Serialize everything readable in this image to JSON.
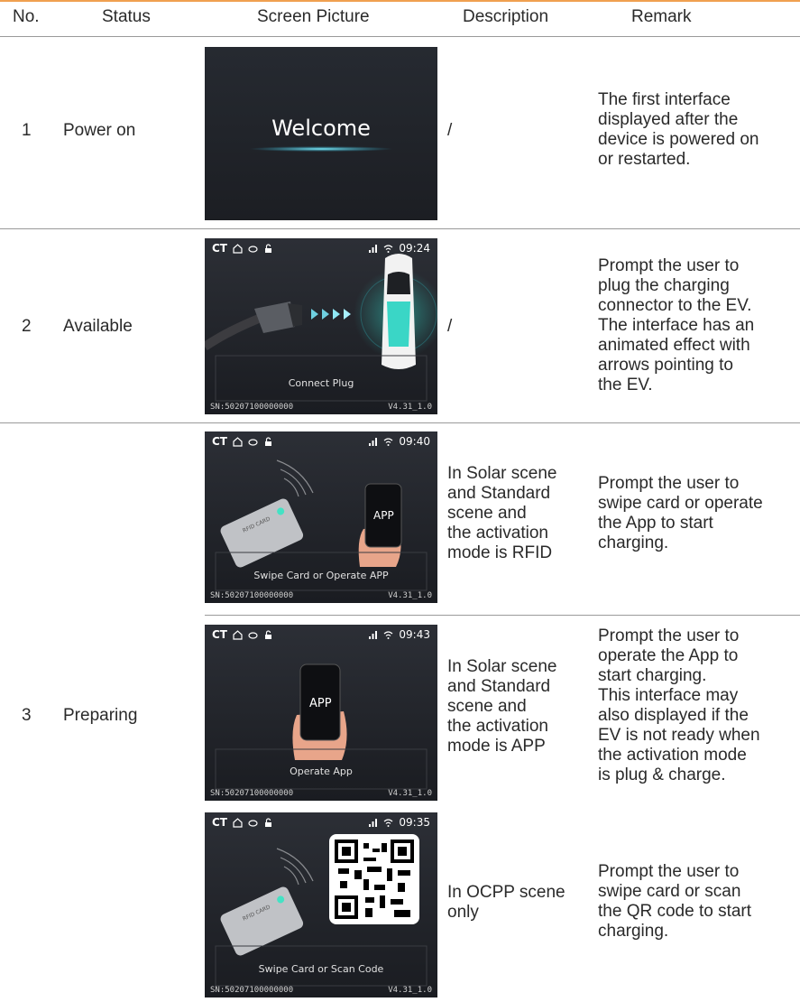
{
  "header": {
    "no": "No.",
    "status": "Status",
    "screen": "Screen Picture",
    "description": "Description",
    "remark": "Remark"
  },
  "rows": [
    {
      "no": "1",
      "status": "Power on",
      "description": "/",
      "remark": [
        "The first interface",
        "displayed after the",
        "device is powered on",
        "or restarted."
      ],
      "screen": {
        "title": "Welcome"
      }
    },
    {
      "no": "2",
      "status": "Available",
      "description": "/",
      "remark": [
        "Prompt the user to",
        "plug the charging",
        "connector to the EV.",
        "The interface has an",
        "animated effect with",
        "arrows pointing to",
        "the EV."
      ],
      "screen": {
        "status_left": "CT",
        "time": "09:24",
        "caption": "Connect Plug",
        "sn": "SN:50207100000000",
        "version": "V4.31_1.0"
      }
    }
  ],
  "group3": {
    "no": "3",
    "status": "Preparing",
    "subrows": [
      {
        "description": [
          "In Solar scene",
          "and Standard",
          "scene and",
          "the activation",
          "mode is RFID"
        ],
        "remark": [
          "Prompt the user to",
          "swipe card or operate",
          "the App to start",
          "charging."
        ],
        "screen": {
          "status_left": "CT",
          "time": "09:40",
          "caption": "Swipe Card or Operate APP",
          "card_label": "RFID CARD",
          "app_label": "APP",
          "sn": "SN:50207100000000",
          "version": "V4.31_1.0"
        }
      },
      {
        "description": [
          "In Solar scene",
          "and Standard",
          "scene and",
          "the activation",
          "mode is APP"
        ],
        "remark": [
          "Prompt the user to",
          "operate the App to",
          "start charging.",
          "This interface may",
          "also displayed if the",
          "EV is not ready when",
          "the activation mode",
          "is plug & charge."
        ],
        "screen": {
          "status_left": "CT",
          "time": "09:43",
          "caption": "Operate App",
          "app_label": "APP",
          "sn": "SN:50207100000000",
          "version": "V4.31_1.0"
        }
      },
      {
        "description": [
          "In OCPP scene",
          "only"
        ],
        "remark": [
          "Prompt the user to",
          "swipe card or scan",
          "the QR code to start",
          "charging."
        ],
        "screen": {
          "status_left": "CT",
          "time": "09:35",
          "caption": "Swipe Card or Scan Code",
          "card_label": "RFID CARD",
          "sn": "SN:50207100000000",
          "version": "V4.31_1.0"
        }
      }
    ]
  }
}
